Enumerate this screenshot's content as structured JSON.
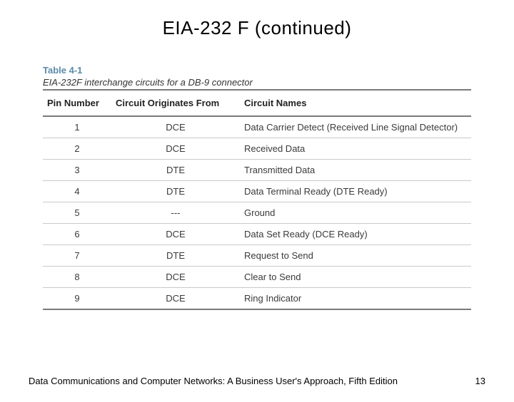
{
  "title": "EIA-232 F (continued)",
  "table": {
    "label": "Table 4-1",
    "caption": "EIA-232F interchange circuits for a DB-9 connector",
    "headers": {
      "pin": "Pin Number",
      "orig": "Circuit Originates From",
      "name": "Circuit Names"
    },
    "rows": [
      {
        "pin": "1",
        "orig": "DCE",
        "name": "Data Carrier Detect (Received Line Signal Detector)"
      },
      {
        "pin": "2",
        "orig": "DCE",
        "name": "Received Data"
      },
      {
        "pin": "3",
        "orig": "DTE",
        "name": "Transmitted Data"
      },
      {
        "pin": "4",
        "orig": "DTE",
        "name": "Data Terminal Ready (DTE Ready)"
      },
      {
        "pin": "5",
        "orig": "---",
        "name": "Ground"
      },
      {
        "pin": "6",
        "orig": "DCE",
        "name": "Data Set Ready (DCE Ready)"
      },
      {
        "pin": "7",
        "orig": "DTE",
        "name": "Request to Send"
      },
      {
        "pin": "8",
        "orig": "DCE",
        "name": "Clear to Send"
      },
      {
        "pin": "9",
        "orig": "DCE",
        "name": "Ring Indicator"
      }
    ]
  },
  "footer": {
    "source": "Data Communications and Computer Networks: A Business User's Approach, Fifth Edition",
    "page": "13"
  }
}
